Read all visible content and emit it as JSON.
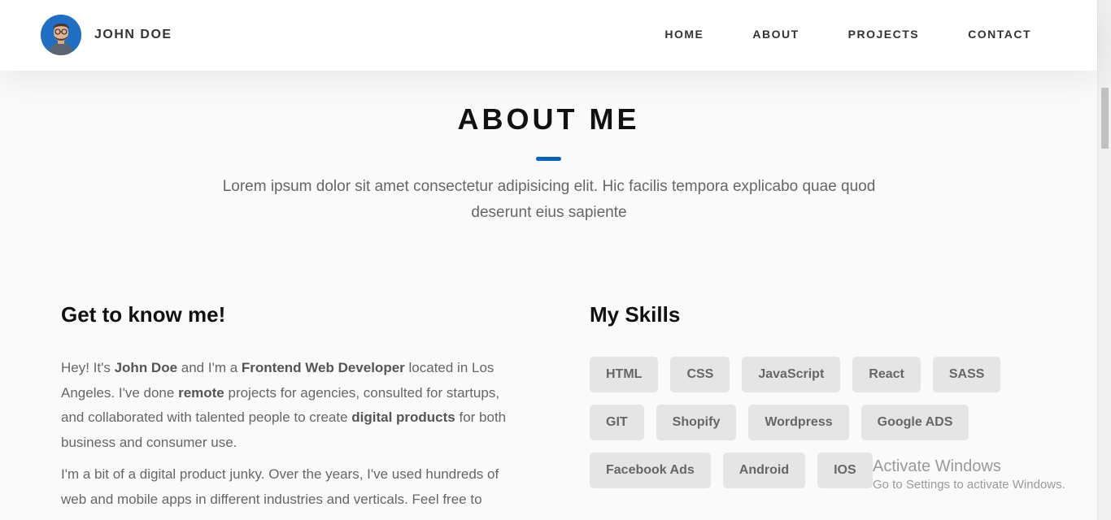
{
  "brand": {
    "name": "JOHN DOE"
  },
  "nav": {
    "items": [
      {
        "label": "HOME"
      },
      {
        "label": "ABOUT"
      },
      {
        "label": "PROJECTS"
      },
      {
        "label": "CONTACT"
      }
    ]
  },
  "about": {
    "title": "ABOUT ME",
    "intro": "Lorem ipsum dolor sit amet consectetur adipisicing elit. Hic facilis tempora explicabo quae quod deserunt eius sapiente",
    "know_heading": "Get to know me!",
    "p1": {
      "t1": "Hey! It's ",
      "b1": "John Doe",
      "t2": " and I'm a ",
      "b2": "Frontend Web Developer",
      "t3": " located in Los Angeles. I've done ",
      "b3": "remote",
      "t4": " projects for agencies, consulted for startups, and collaborated with talented people to create ",
      "b4": "digital products",
      "t5": " for both business and consumer use."
    },
    "p2": "I'm a bit of a digital product junky. Over the years, I've used hundreds of web and mobile apps in different industries and verticals. Feel free to",
    "skills_heading": "My Skills",
    "skills": [
      "HTML",
      "CSS",
      "JavaScript",
      "React",
      "SASS",
      "GIT",
      "Shopify",
      "Wordpress",
      "Google ADS",
      "Facebook Ads",
      "Android",
      "IOS"
    ]
  },
  "watermark": {
    "title": "Activate Windows",
    "subtitle": "Go to Settings to activate Windows."
  },
  "colors": {
    "accent": "#0062b9",
    "skill_bg": "#e5e5e5",
    "background": "#fafafa"
  }
}
